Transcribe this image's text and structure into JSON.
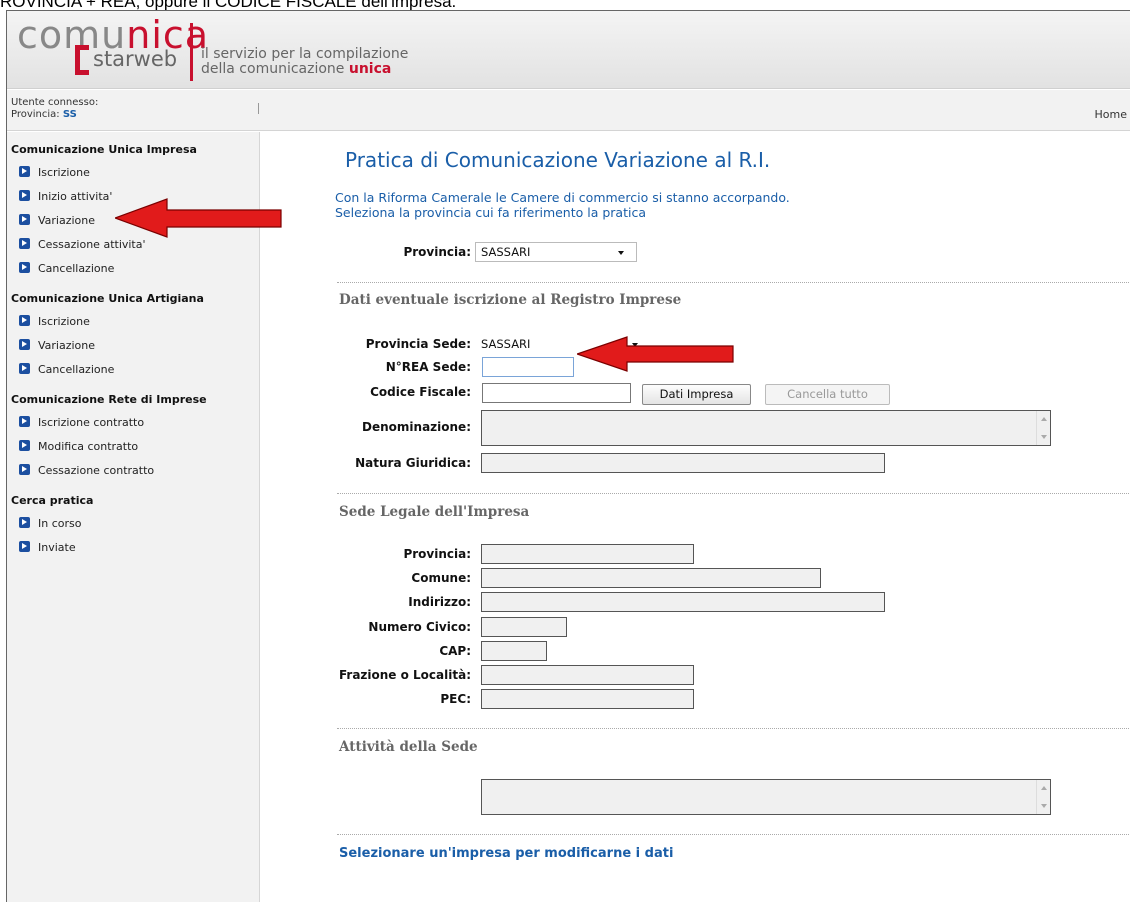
{
  "caption": "ROVINCIA + REA, oppure il CODICE FISCALE dell'impresa.",
  "header": {
    "logo_main": "comu",
    "logo_accent": "nica",
    "logo_sub": "starweb",
    "tagline_line1": "il servizio per la compilazione",
    "tagline_line2_prefix": "della comunicazione ",
    "tagline_line2_accent": "unica"
  },
  "userbar": {
    "user_label": "Utente connesso:",
    "province_label": "Provincia:",
    "province_value": "SS",
    "home_link": "Home"
  },
  "sidebar": {
    "groups": [
      {
        "title": "Comunicazione Unica Impresa",
        "items": [
          "Iscrizione",
          "Inizio attivita'",
          "Variazione",
          "Cessazione attivita'",
          "Cancellazione"
        ]
      },
      {
        "title": "Comunicazione Unica Artigiana",
        "items": [
          "Iscrizione",
          "Variazione",
          "Cancellazione"
        ]
      },
      {
        "title": "Comunicazione Rete di Imprese",
        "items": [
          "Iscrizione contratto",
          "Modifica contratto",
          "Cessazione contratto"
        ]
      },
      {
        "title": "Cerca pratica",
        "items": [
          "In corso",
          "Inviate"
        ]
      }
    ]
  },
  "main": {
    "title": "Pratica di Comunicazione Variazione al R.I.",
    "intro_line1": "Con la Riforma Camerale le Camere di commercio si stanno accorpando.",
    "intro_line2": "Seleziona la provincia cui fa riferimento la pratica",
    "provincia_label": "Provincia:",
    "provincia_value": "SASSARI",
    "section_registro": "Dati eventuale iscrizione al Registro Imprese",
    "provincia_sede_label": "Provincia Sede:",
    "provincia_sede_value": "SASSARI",
    "rea_label": "N°REA Sede:",
    "codice_fiscale_label": "Codice Fiscale:",
    "dati_impresa_button": "Dati Impresa",
    "cancella_button": "Cancella tutto",
    "denominazione_label": "Denominazione:",
    "natura_label": "Natura Giuridica:",
    "section_sede": "Sede Legale dell'Impresa",
    "sede_provincia_label": "Provincia:",
    "comune_label": "Comune:",
    "indirizzo_label": "Indirizzo:",
    "civico_label": "Numero Civico:",
    "cap_label": "CAP:",
    "frazione_label": "Frazione o Località:",
    "pec_label": "PEC:",
    "section_attivita": "Attività della Sede",
    "select_impresa": "Selezionare un'impresa per modificarne i dati"
  },
  "colors": {
    "accent": "#c8102e",
    "link": "#1a5ea8",
    "annotation_arrow": "#e11b1b"
  }
}
